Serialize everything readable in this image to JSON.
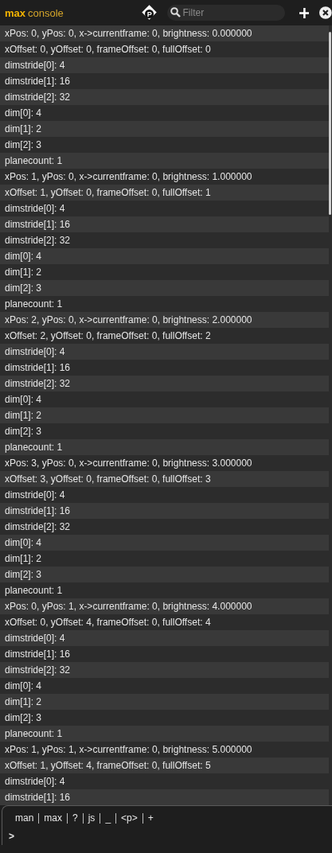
{
  "header": {
    "title_bold": "max",
    "title_rest": "console",
    "badge": "P",
    "search": {
      "placeholder": "Filter"
    }
  },
  "rows": [
    "xPos: 0, yPos: 0, x->currentframe: 0, brightness: 0.000000",
    "xOffset: 0, yOffset: 0, frameOffset: 0, fullOffset: 0",
    "dimstride[0]: 4",
    "dimstride[1]: 16",
    "dimstride[2]: 32",
    "dim[0]: 4",
    "dim[1]: 2",
    "dim[2]: 3",
    "planecount: 1",
    "xPos: 1, yPos: 0, x->currentframe: 0, brightness: 1.000000",
    "xOffset: 1, yOffset: 0, frameOffset: 0, fullOffset: 1",
    "dimstride[0]: 4",
    "dimstride[1]: 16",
    "dimstride[2]: 32",
    "dim[0]: 4",
    "dim[1]: 2",
    "dim[2]: 3",
    "planecount: 1",
    "xPos: 2, yPos: 0, x->currentframe: 0, brightness: 2.000000",
    "xOffset: 2, yOffset: 0, frameOffset: 0, fullOffset: 2",
    "dimstride[0]: 4",
    "dimstride[1]: 16",
    "dimstride[2]: 32",
    "dim[0]: 4",
    "dim[1]: 2",
    "dim[2]: 3",
    "planecount: 1",
    "xPos: 3, yPos: 0, x->currentframe: 0, brightness: 3.000000",
    "xOffset: 3, yOffset: 0, frameOffset: 0, fullOffset: 3",
    "dimstride[0]: 4",
    "dimstride[1]: 16",
    "dimstride[2]: 32",
    "dim[0]: 4",
    "dim[1]: 2",
    "dim[2]: 3",
    "planecount: 1",
    "xPos: 0, yPos: 1, x->currentframe: 0, brightness: 4.000000",
    "xOffset: 0, yOffset: 4, frameOffset: 0, fullOffset: 4",
    "dimstride[0]: 4",
    "dimstride[1]: 16",
    "dimstride[2]: 32",
    "dim[0]: 4",
    "dim[1]: 2",
    "dim[2]: 3",
    "planecount: 1",
    "xPos: 1, yPos: 1, x->currentframe: 0, brightness: 5.000000",
    "xOffset: 1, yOffset: 4, frameOffset: 0, fullOffset: 5",
    "dimstride[0]: 4",
    "dimstride[1]: 16"
  ],
  "footer": {
    "shortcuts": [
      "man",
      "max",
      "?",
      "js",
      "_",
      "<p>",
      "+"
    ],
    "prompt": ">"
  }
}
